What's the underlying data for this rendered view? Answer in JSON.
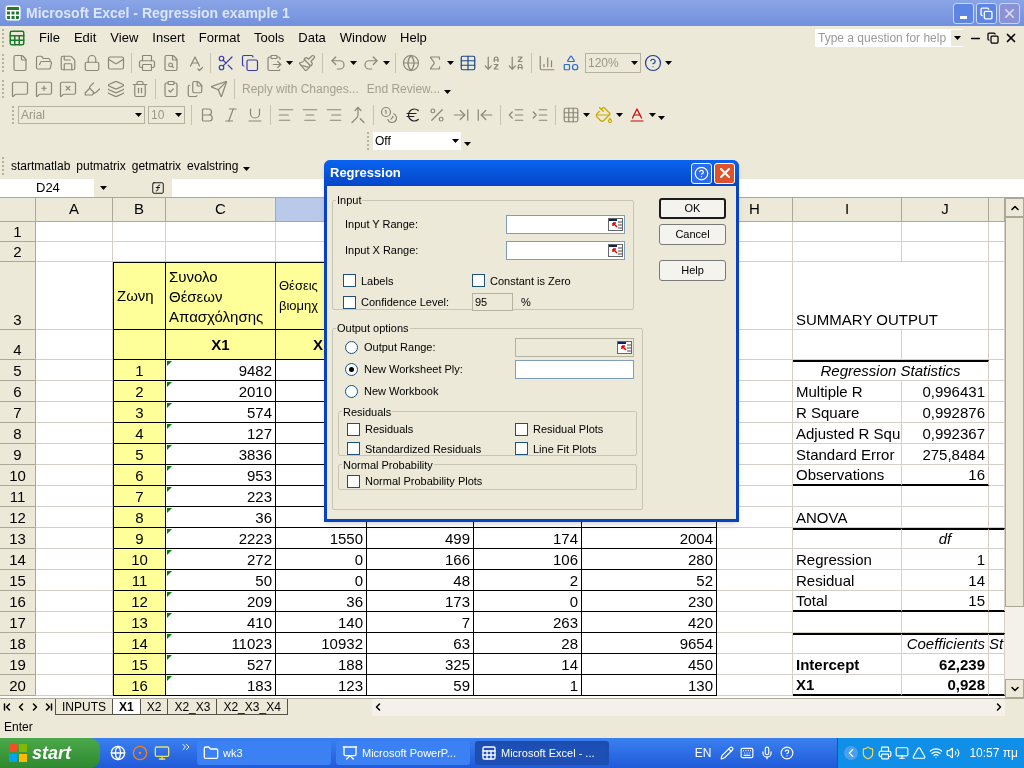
{
  "window": {
    "title": "Microsoft Excel - Regression example 1"
  },
  "menu": [
    "File",
    "Edit",
    "View",
    "Insert",
    "Format",
    "Tools",
    "Data",
    "Window",
    "Help"
  ],
  "help_box": {
    "placeholder": "Type a question for help"
  },
  "standard_toolbar": {
    "zoom": "120%"
  },
  "reviewing_toolbar": {
    "items": [
      {
        "label": "Reply with Changes...",
        "disabled": true
      },
      {
        "label": "End Review...",
        "disabled": true
      }
    ]
  },
  "formatting_toolbar": {
    "font": "Arial",
    "size": "10"
  },
  "combo_toolbar": {
    "value": "Off"
  },
  "matlab_toolbar": [
    "startmatlab",
    "putmatrix",
    "getmatrix",
    "evalstring"
  ],
  "formula_bar": {
    "name_box": "D24"
  },
  "sheet": {
    "columns": [
      {
        "label": "A",
        "selected": false
      },
      {
        "label": "B",
        "selected": false
      },
      {
        "label": "C",
        "selected": false
      },
      {
        "selected": true
      },
      {},
      {},
      {},
      {
        "label": "H",
        "selected": false
      },
      {
        "label": "I",
        "selected": false
      },
      {
        "label": "J",
        "selected": false
      },
      {
        "selected": false
      }
    ],
    "rows": [
      {
        "label": "1",
        "cells": {}
      },
      {
        "label": "2",
        "cells": {}
      },
      {
        "label": "3",
        "cells": {
          "B": "Ζωνη",
          "C": "Συνολο Θέσεων Απασχόλησης",
          "D": "Θέσεις βιομηχ",
          "I": "SUMMARY OUTPUT"
        }
      },
      {
        "label": "4",
        "cells": {
          "C": "X1",
          "D": "X"
        }
      },
      {
        "label": "5",
        "cells": {
          "B": "1",
          "C": "9482",
          "I": "Regression Statistics"
        }
      },
      {
        "label": "6",
        "cells": {
          "B": "2",
          "C": "2010",
          "I": "Multiple R",
          "J": "0,996431"
        }
      },
      {
        "label": "7",
        "cells": {
          "B": "3",
          "C": "574",
          "I": "R Square",
          "J": "0,992876"
        }
      },
      {
        "label": "8",
        "cells": {
          "B": "4",
          "C": "127",
          "I": "Adjusted R Squ",
          "J": "0,992367"
        }
      },
      {
        "label": "9",
        "cells": {
          "B": "5",
          "C": "3836",
          "I": "Standard Error",
          "J": "275,8484"
        }
      },
      {
        "label": "10",
        "cells": {
          "B": "6",
          "C": "953",
          "I": "Observations",
          "J": "16"
        }
      },
      {
        "label": "11",
        "cells": {
          "B": "7",
          "C": "223"
        }
      },
      {
        "label": "12",
        "cells": {
          "B": "8",
          "C": "36",
          "I": "ANOVA"
        }
      },
      {
        "label": "13",
        "cells": {
          "B": "9",
          "C": "2223",
          "D": "1550",
          "E": "499",
          "F": "174",
          "G": "2004",
          "J": "df"
        }
      },
      {
        "label": "14",
        "cells": {
          "B": "10",
          "C": "272",
          "D": "0",
          "E": "166",
          "F": "106",
          "G": "280",
          "I": "Regression",
          "J": "1"
        }
      },
      {
        "label": "15",
        "cells": {
          "B": "11",
          "C": "50",
          "D": "0",
          "E": "48",
          "F": "2",
          "G": "52",
          "I": "Residual",
          "J": "14"
        }
      },
      {
        "label": "16",
        "cells": {
          "B": "12",
          "C": "209",
          "D": "36",
          "E": "173",
          "F": "0",
          "G": "230",
          "I": "Total",
          "J": "15"
        }
      },
      {
        "label": "17",
        "cells": {
          "B": "13",
          "C": "410",
          "D": "140",
          "E": "7",
          "F": "263",
          "G": "420"
        }
      },
      {
        "label": "18",
        "cells": {
          "B": "14",
          "C": "11023",
          "D": "10932",
          "E": "63",
          "F": "28",
          "G": "9654",
          "J": "Coefficients",
          "K": "St"
        }
      },
      {
        "label": "19",
        "cells": {
          "B": "15",
          "C": "527",
          "D": "188",
          "E": "325",
          "F": "14",
          "G": "450",
          "I": "Intercept",
          "J": "62,239"
        }
      },
      {
        "label": "20",
        "cells": {
          "B": "16",
          "C": "183",
          "D": "123",
          "E": "59",
          "F": "1",
          "G": "130",
          "I": "X1",
          "J": "0,928"
        }
      }
    ]
  },
  "dialog": {
    "title": "Regression",
    "input_group": {
      "title": "Input",
      "ranges": [
        {
          "label": "Input Y Range:"
        },
        {
          "label": "Input X Range:"
        }
      ],
      "labels": {
        "label": "Labels",
        "checked": false
      },
      "constant_zero": {
        "label": "Constant is Zero",
        "checked": false
      },
      "confidence": {
        "label": "Confidence Level:",
        "checked": false,
        "value": "95",
        "unit": "%"
      }
    },
    "output_group": {
      "title": "Output options",
      "options": [
        {
          "label": "Output Range:",
          "selected": false,
          "kind": "range"
        },
        {
          "label": "New Worksheet Ply:",
          "selected": true,
          "kind": "text"
        },
        {
          "label": "New Workbook",
          "selected": false,
          "kind": "plain"
        }
      ]
    },
    "residuals_group": {
      "title": "Residuals",
      "options": [
        {
          "label": "Residuals",
          "checked": false
        },
        {
          "label": "Residual Plots",
          "checked": false
        },
        {
          "label": "Standardized Residuals",
          "checked": false
        },
        {
          "label": "Line Fit Plots",
          "checked": false
        }
      ]
    },
    "normal_group": {
      "title": "Normal Probability",
      "options": [
        {
          "label": "Normal Probability Plots",
          "checked": false
        }
      ]
    },
    "buttons": [
      "OK",
      "Cancel",
      "Help"
    ]
  },
  "sheet_tabs": [
    {
      "label": "INPUTS",
      "selected": false
    },
    {
      "label": "X1",
      "selected": true
    },
    {
      "label": "X2",
      "selected": false
    },
    {
      "label": "X2_X3",
      "selected": false
    },
    {
      "label": "X2_X3_X4",
      "selected": false
    }
  ],
  "status_bar": "Enter",
  "taskbar": {
    "start": "start",
    "tasks": [
      {
        "label": "wk3",
        "kind": "folder",
        "selected": false
      },
      {
        "label": "Microsoft PowerP...",
        "kind": "slides",
        "selected": false
      },
      {
        "label": "Microsoft Excel - ...",
        "kind": "sheet",
        "selected": true
      }
    ],
    "language": "EN",
    "clock": "10:57 πμ"
  }
}
